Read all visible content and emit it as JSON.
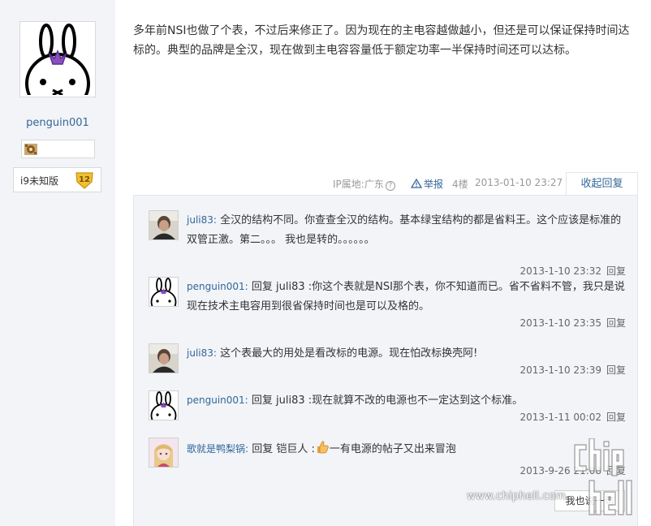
{
  "author": {
    "username": "penguin001",
    "group_label": "i9未知版",
    "level": "12"
  },
  "post": {
    "text": "多年前NSI也做了个表，不过后来修正了。因为现在的主电容越做越小，但还是可以保证保持时间达标的。典型的品牌是全汉，现在做到主电容容量低于额定功率一半保持时间还可以达标。",
    "ip_label": "IP属地:广东",
    "help_glyph": "?",
    "report_label": "举报",
    "floor": "4楼",
    "date": "2013-01-10 23:27",
    "collapse_label": "收起回复"
  },
  "replies": [
    {
      "name": "juli83:",
      "text": "全汉的结构不同。你查查全汉的结构。基本绿宝结构的都是省料王。这个应该是标准的双管正激。第二。。。 我也是转的。。。。。。",
      "time": "2013-1-10 23:32",
      "reply_label": "回复",
      "avatar": "photo-avatar"
    },
    {
      "name": "penguin001:",
      "text": "回复 juli83 :你这个表就是NSI那个表，你不知道而已。省不省料不管，我只是说现在技术主电容用到很省保持时间也是可以及格的。",
      "time": "2013-1-10 23:35",
      "reply_label": "回复",
      "avatar": "bunny-avatar"
    },
    {
      "name": "juli83:",
      "text": "这个表最大的用处是看改标的电源。现在怕改标换壳阿!",
      "time": "2013-1-10 23:39",
      "reply_label": "回复",
      "avatar": "photo-avatar"
    },
    {
      "name": "penguin001:",
      "text": "回复 juli83 :现在就算不改的电源也不一定达到这个标准。",
      "time": "2013-1-11 00:02",
      "reply_label": "回复",
      "avatar": "bunny-avatar"
    },
    {
      "name": "歌就是鸭梨锅:",
      "text_before": "回复 铠巨人 :",
      "text_after": "一有电源的帖子又出来冒泡",
      "time": "2013-9-26 21:08",
      "reply_label": "回复",
      "avatar": "anime-avatar"
    }
  ],
  "more_label": "我也说一句",
  "watermark": {
    "url": "www.chiphell.com",
    "logo_text": "chip hell"
  },
  "colors": {
    "link": "#336699",
    "panel_bg": "#f2f4f8",
    "bunny_flower": "#8a4fc0",
    "badge_gold": "#f0c030"
  }
}
